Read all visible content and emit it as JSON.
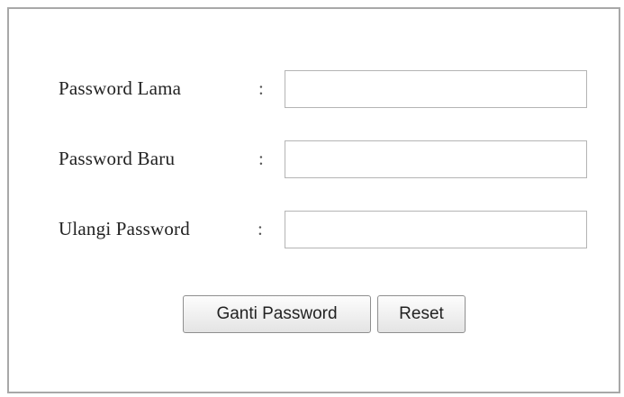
{
  "form": {
    "fields": [
      {
        "label": "Password Lama",
        "separator": ":",
        "value": "",
        "placeholder": ""
      },
      {
        "label": "Password Baru",
        "separator": ":",
        "value": "",
        "placeholder": ""
      },
      {
        "label": "Ulangi Password",
        "separator": ":",
        "value": "",
        "placeholder": ""
      }
    ],
    "submit_label": "Ganti Password",
    "reset_label": "Reset"
  }
}
